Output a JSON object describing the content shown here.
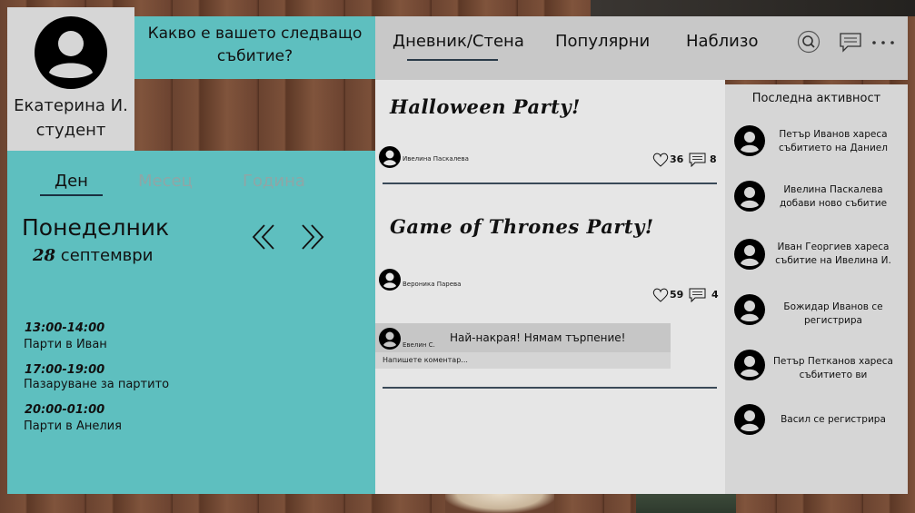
{
  "profile": {
    "name": "Екатерина И.",
    "role": "студент"
  },
  "question": "Какво е вашето следващо събитие?",
  "calendar": {
    "tabs": [
      "Ден",
      "Месец",
      "Година"
    ],
    "weekday": "Понеделник",
    "date_number": "28",
    "month": "септември",
    "events": [
      {
        "time": "13:00-14:00",
        "name": "Парти в Иван"
      },
      {
        "time": "17:00-19:00",
        "name": "Пазаруване за партито"
      },
      {
        "time": "20:00-01:00",
        "name": "Парти в Анелия"
      }
    ]
  },
  "nav": {
    "items": [
      "Дневник/Стена",
      "Популярни",
      "Наблизо"
    ],
    "icons": [
      "search-icon",
      "chat-icon",
      "more-icon"
    ]
  },
  "feed": {
    "posts": [
      {
        "title": "Halloween Party!",
        "author": "Ивелина Паскалева",
        "likes": "36",
        "comments": "8"
      },
      {
        "title": "Game of Thrones Party!",
        "author": "Вероника Парева",
        "likes": "59",
        "comments": "4"
      }
    ],
    "comment": {
      "author": "Евелин С.",
      "text": "Най-накрая! Нямам търпение!"
    },
    "comment_placeholder": "Напишете коментар..."
  },
  "activity": {
    "title": "Последна активност",
    "items": [
      "Петър Иванов хареса събитието на Даниел",
      "Ивелина Паскалева добави ново събитие",
      "Иван Георгиев хареса събитие на Ивелина И.",
      "Божидар Иванов се регистрира",
      "Петър Петканов хареса събитието ви",
      "Васил се регистрира"
    ]
  },
  "colors": {
    "teal": "#5ebfbf",
    "nav_bg": "#c8c8c8",
    "feed_bg": "#e6e6e6",
    "panel_gray": "#d6d6d6"
  }
}
